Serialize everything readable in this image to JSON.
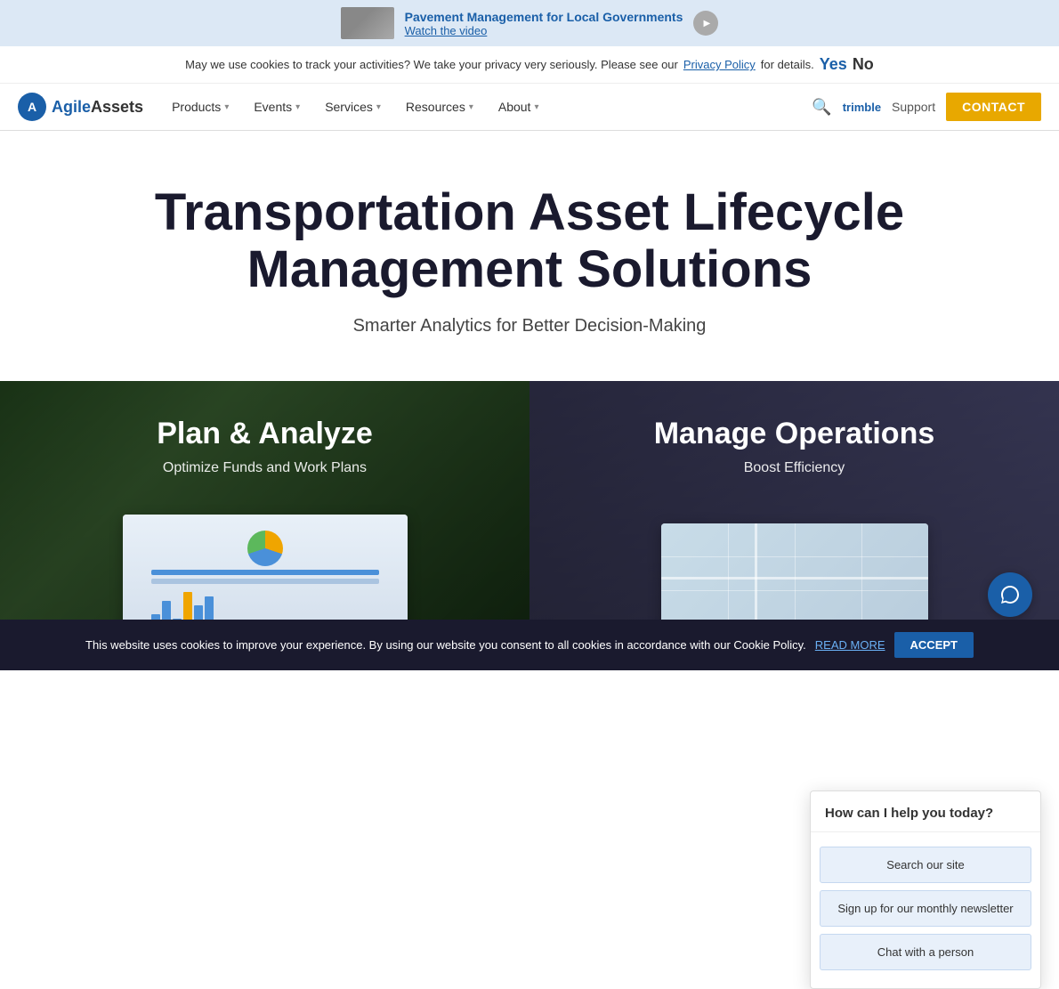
{
  "ad_banner": {
    "title": "Pavement Management for Local Governments",
    "subtitle": "Watch the video"
  },
  "cookie_top": {
    "text": "May we use cookies to track your activities? We take your privacy very seriously. Please see our",
    "link": "Privacy Policy",
    "link_suffix": "for details.",
    "yes_label": "Yes",
    "no_label": "No"
  },
  "navbar": {
    "logo_text": "AgileAssets",
    "products_label": "Products",
    "events_label": "Events",
    "services_label": "Services",
    "resources_label": "Resources",
    "about_label": "About",
    "support_label": "Support",
    "contact_label": "CONTACT"
  },
  "hero": {
    "title": "Transportation Asset Lifecycle Management Solutions",
    "subtitle": "Smarter Analytics for Better Decision-Making"
  },
  "cards": [
    {
      "title": "Plan & Analyze",
      "subtitle": "Optimize Funds and Work Plans"
    },
    {
      "title": "Manage Operations",
      "subtitle": "Boost Efficiency"
    }
  ],
  "chat_widget": {
    "header": "How can I help you today?",
    "options": [
      "Search our site",
      "Sign up for our monthly newsletter",
      "Chat with a person"
    ]
  },
  "cookie_bottom": {
    "text": "This website uses cookies to improve your experience. By using our website you consent to all cookies in accordance with our Cookie Policy.",
    "link": "READ MORE",
    "btn_label": "ACCEPT"
  }
}
